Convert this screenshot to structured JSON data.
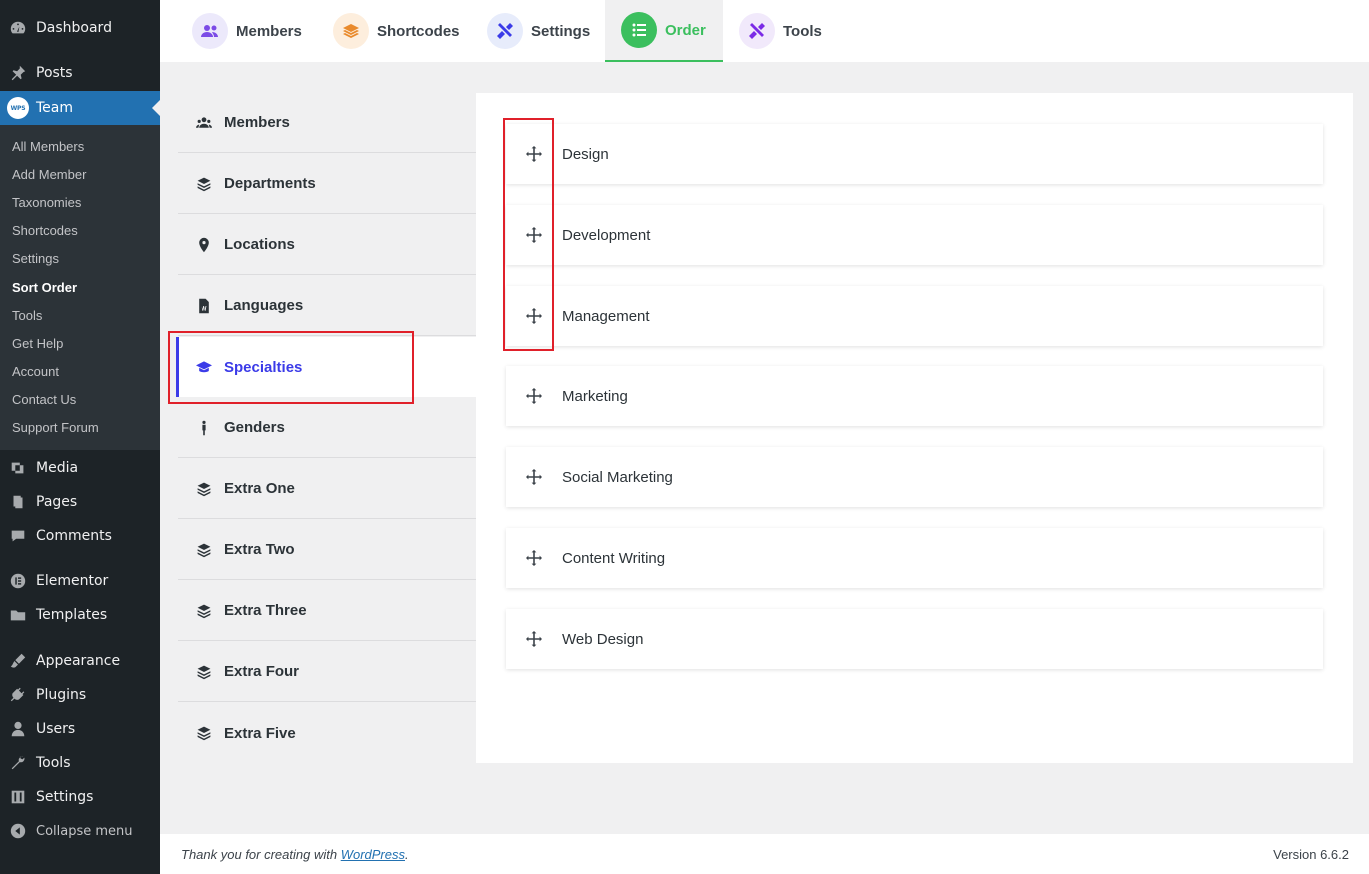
{
  "sidebar": {
    "dashboard": "Dashboard",
    "posts": "Posts",
    "team": "Team",
    "team_badge": "WPS",
    "submenu": [
      "All Members",
      "Add Member",
      "Taxonomies",
      "Shortcodes",
      "Settings",
      "Sort Order",
      "Tools",
      "Get Help",
      "Account",
      "Contact Us",
      "Support Forum"
    ],
    "submenu_active": "Sort Order",
    "media": "Media",
    "pages": "Pages",
    "comments": "Comments",
    "elementor": "Elementor",
    "templates": "Templates",
    "appearance": "Appearance",
    "plugins": "Plugins",
    "users": "Users",
    "tools": "Tools",
    "settings": "Settings",
    "collapse": "Collapse menu"
  },
  "top_tabs": {
    "members": "Members",
    "shortcodes": "Shortcodes",
    "settings": "Settings",
    "order": "Order",
    "tools": "Tools",
    "active": "Order"
  },
  "taxonomy_nav": {
    "items": [
      "Members",
      "Departments",
      "Locations",
      "Languages",
      "Specialties",
      "Genders",
      "Extra One",
      "Extra Two",
      "Extra Three",
      "Extra Four",
      "Extra Five"
    ],
    "active": "Specialties"
  },
  "terms": [
    "Design",
    "Development",
    "Management",
    "Marketing",
    "Social Marketing",
    "Content Writing",
    "Web Design"
  ],
  "footer": {
    "thanks_prefix": "Thank you for creating with ",
    "thanks_link": "WordPress",
    "thanks_suffix": ".",
    "version": "Version 6.6.2"
  },
  "colors": {
    "accent_blue": "#2271b1",
    "order_green": "#3bbf5e",
    "active_nav": "#3b3be8",
    "highlight_red": "#e0202a"
  }
}
